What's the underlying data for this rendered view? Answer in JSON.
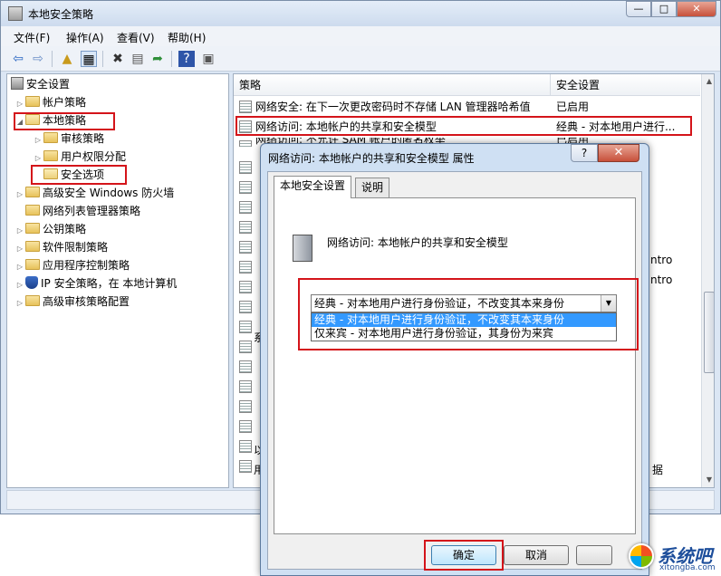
{
  "window": {
    "title": "本地安全策略",
    "minimize": "—",
    "maximize": "□",
    "close": "✕"
  },
  "menu": [
    "文件(F)",
    "操作(A)",
    "查看(V)",
    "帮助(H)"
  ],
  "toolbar_icons": [
    "back-arrow-icon",
    "forward-arrow-icon",
    "folder-up-icon",
    "show-tree-icon",
    "delete-icon",
    "properties-icon",
    "export-icon",
    "help-icon",
    "console-icon"
  ],
  "tree": {
    "root": "安全设置",
    "account_policy": "帐户策略",
    "local_policy": "本地策略",
    "audit_policy": "审核策略",
    "user_rights": "用户权限分配",
    "security_options": "安全选项",
    "firewall": "高级安全 Windows 防火墙",
    "network_list": "网络列表管理器策略",
    "public_key": "公钥策略",
    "software_restriction": "软件限制策略",
    "app_control": "应用程序控制策略",
    "ip_security": "IP 安全策略，在 本地计算机",
    "advanced_audit": "高级审核策略配置"
  },
  "list": {
    "col_policy": "策略",
    "col_setting": "安全设置",
    "rows": [
      {
        "name": "网络安全: 在下一次更改密码时不存储 LAN 管理器哈希值",
        "setting": "已启用"
      },
      {
        "name": "网络访问: 本地帐户的共享和安全模型",
        "setting": "经典 - 对本地用户进行..."
      },
      {
        "name": "网络访问: 不允许 SAM 帐户的匿名枚举",
        "setting": "已启用"
      }
    ],
    "partial_fragments": {
      "r_ntro1": "ntro",
      "r_ntro2": "ntro",
      "r_ju": "据",
      "left_frag1": "系",
      "left_frag2": "以",
      "left_frag3": "用"
    }
  },
  "dialog": {
    "title": "网络访问: 本地帐户的共享和安全模型 属性",
    "help": "?",
    "close": "✕",
    "tab_local": "本地安全设置",
    "tab_explain": "说明",
    "policy_name": "网络访问: 本地帐户的共享和安全模型",
    "selected": "经典 - 对本地用户进行身份验证，不改变其本来身份",
    "options": [
      "经典 - 对本地用户进行身份验证，不改变其本来身份",
      "仅来宾 - 对本地用户进行身份验证，其身份为来宾"
    ],
    "ok": "确定",
    "cancel": "取消",
    "apply": ""
  },
  "watermark": {
    "brand": "系统吧",
    "url": "xitongba.com"
  }
}
